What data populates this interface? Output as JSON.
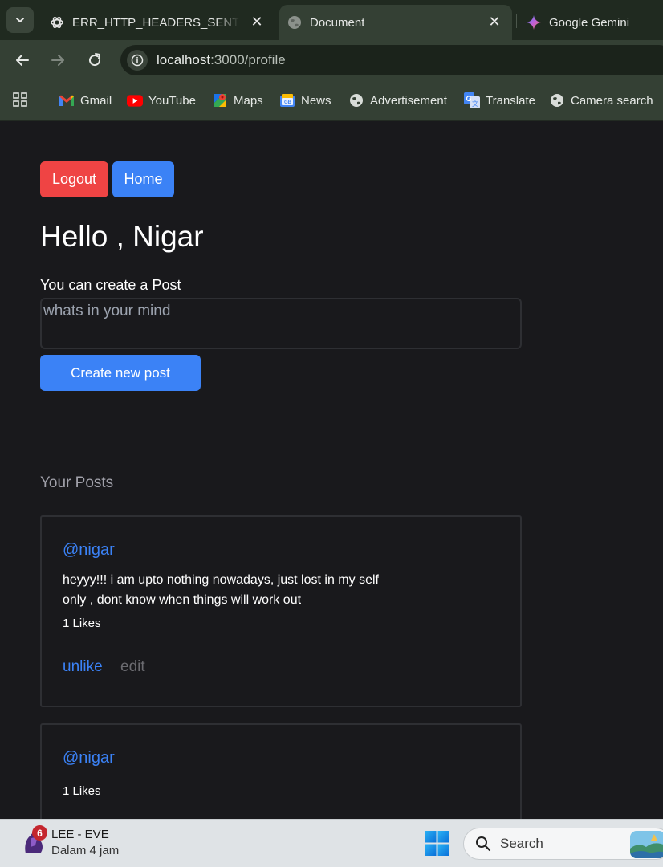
{
  "browser": {
    "tabs": [
      {
        "title": "ERR_HTTP_HEADERS_SENT expl",
        "icon": "chatgpt-icon",
        "active": false,
        "closable": true
      },
      {
        "title": "Document",
        "icon": "globe-icon",
        "active": true,
        "closable": true
      },
      {
        "title": "Google Gemini",
        "icon": "gemini-icon",
        "active": false,
        "closable": false
      }
    ],
    "url_host": "localhost",
    "url_path": ":3000/profile",
    "bookmarks": [
      {
        "label": "Gmail",
        "icon": "gmail-icon"
      },
      {
        "label": "YouTube",
        "icon": "youtube-icon"
      },
      {
        "label": "Maps",
        "icon": "maps-icon"
      },
      {
        "label": "News",
        "icon": "news-icon"
      },
      {
        "label": "Advertisement",
        "icon": "globe-icon"
      },
      {
        "label": "Translate",
        "icon": "translate-icon"
      },
      {
        "label": "Camera search",
        "icon": "globe-icon"
      }
    ]
  },
  "page": {
    "logout_label": "Logout",
    "home_label": "Home",
    "greeting": "Hello , Nigar",
    "create_label": "You can create a Post",
    "input_placeholder": "whats in your mind",
    "create_button": "Create new post",
    "posts_heading": "Your Posts",
    "posts": [
      {
        "author": "@nigar",
        "content": "heyyy!!! i am upto nothing nowadays, just lost in my self only , dont know when things will work out",
        "likes": "1 Likes",
        "like_action": "unlike",
        "edit_action": "edit"
      },
      {
        "author": "@nigar",
        "content": "",
        "likes": "1 Likes"
      }
    ]
  },
  "taskbar": {
    "widget_badge": "6",
    "widget_title": "LEE - EVE",
    "widget_subtitle": "Dalam 4 jam",
    "search_placeholder": "Search"
  },
  "colors": {
    "page_bg": "#19191c",
    "logout_bg": "#ef4444",
    "primary_blue": "#3b82f6",
    "chrome_frame": "#344034"
  }
}
